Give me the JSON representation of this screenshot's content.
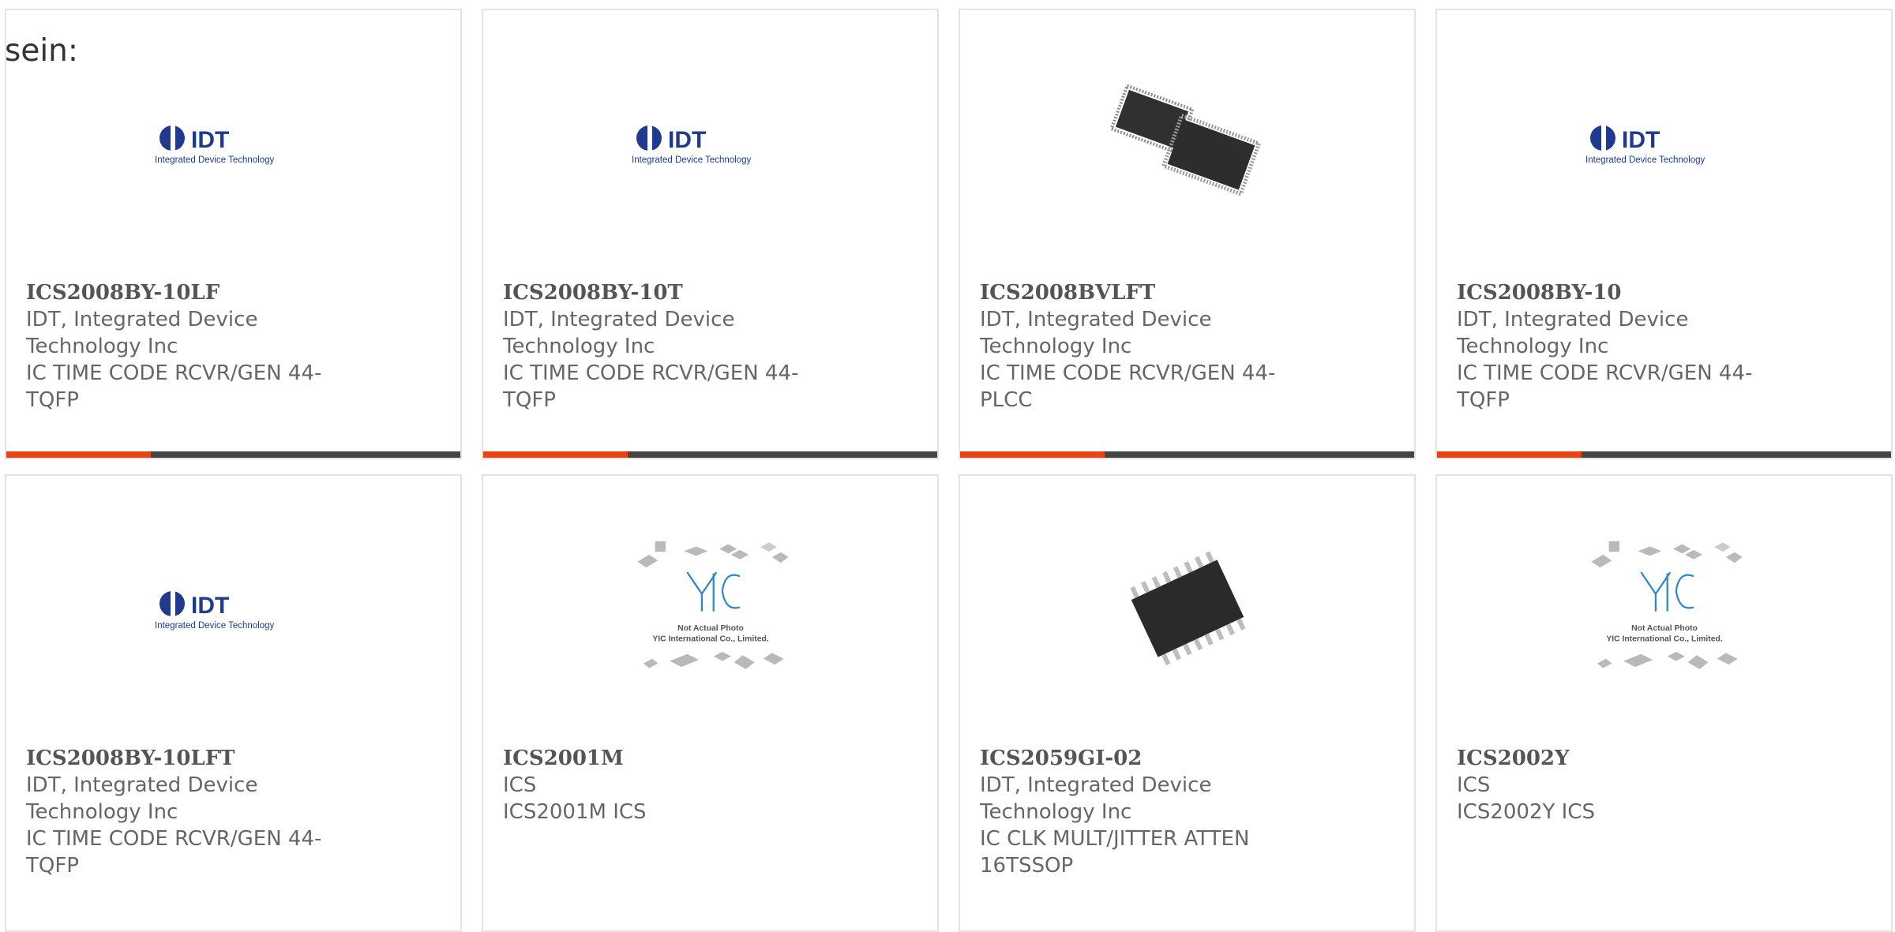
{
  "page": {
    "title": "sein:"
  },
  "colors": {
    "accent": "#e94214",
    "bar": "#444444",
    "text": "#666666",
    "border": "#e3e3e3",
    "idt_blue": "#1f3a8f",
    "yic_blue": "#2a86c7"
  },
  "products": [
    {
      "part_number": "ICS2008BY-10LF",
      "manufacturer": "IDT, Integrated Device Technology Inc",
      "description": "IC TIME CODE RCVR/GEN 44-TQFP",
      "image": "idt-logo"
    },
    {
      "part_number": "ICS2008BY-10T",
      "manufacturer": "IDT, Integrated Device Technology Inc",
      "description": "IC TIME CODE RCVR/GEN 44-TQFP",
      "image": "idt-logo"
    },
    {
      "part_number": "ICS2008BVLFT",
      "manufacturer": "IDT, Integrated Device Technology Inc",
      "description": "IC TIME CODE RCVR/GEN 44-PLCC",
      "image": "plcc-chip-photo"
    },
    {
      "part_number": "ICS2008BY-10",
      "manufacturer": "IDT, Integrated Device Technology Inc",
      "description": "IC TIME CODE RCVR/GEN 44-TQFP",
      "image": "idt-logo"
    },
    {
      "part_number": "ICS2008BY-10LFT",
      "manufacturer": "IDT, Integrated Device Technology Inc",
      "description": "IC TIME CODE RCVR/GEN 44-TQFP",
      "image": "idt-logo"
    },
    {
      "part_number": "ICS2001M",
      "manufacturer": "ICS",
      "description": "ICS2001M ICS",
      "image": "yic-placeholder"
    },
    {
      "part_number": "ICS2059GI-02",
      "manufacturer": "IDT, Integrated Device Technology Inc",
      "description": "IC CLK MULT/JITTER ATTEN 16TSSOP",
      "image": "tssop-chip-photo"
    },
    {
      "part_number": "ICS2002Y",
      "manufacturer": "ICS",
      "description": "ICS2002Y ICS",
      "image": "yic-placeholder"
    }
  ],
  "logos": {
    "idt": {
      "wordmark": "IDT",
      "tagline": "Integrated Device Technology"
    },
    "yic": {
      "wordmark": "YIC",
      "line1": "Not Actual Photo",
      "line2": "YIC International Co., Limited."
    }
  }
}
